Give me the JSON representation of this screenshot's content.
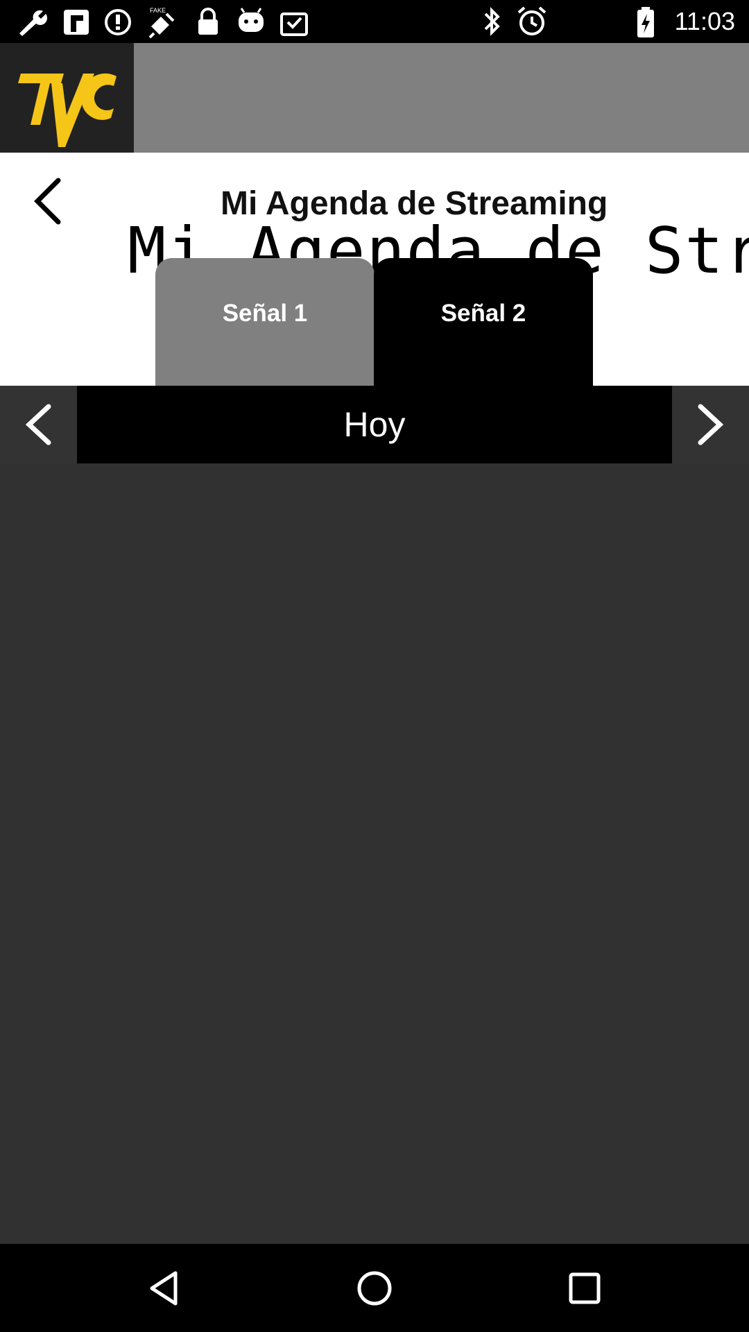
{
  "status_bar": {
    "time": "11:03",
    "left_icons": [
      "wrench-icon",
      "flipboard-icon",
      "alert-icon",
      "fake-gps-icon",
      "lock-icon",
      "android-icon",
      "clipboard-check-icon"
    ],
    "right_icons": [
      "bluetooth-icon",
      "alarm-icon",
      "battery-icon"
    ]
  },
  "header": {
    "logo_text": "TVC",
    "logo_color": "#F5C518"
  },
  "title_area": {
    "title": "Mi Agenda de Streaming",
    "script_title": "Mi Agenda de Streaming"
  },
  "tabs": [
    {
      "label": "Señal 1",
      "active": false
    },
    {
      "label": "Señal 2",
      "active": true
    }
  ],
  "day_nav": {
    "label": "Hoy"
  },
  "nav_bar": {
    "buttons": [
      "back-icon",
      "home-icon",
      "recents-icon"
    ]
  },
  "colors": {
    "banner": "#808080",
    "content_bg": "#313131",
    "active_tab": "#000000",
    "inactive_tab": "#808080"
  }
}
